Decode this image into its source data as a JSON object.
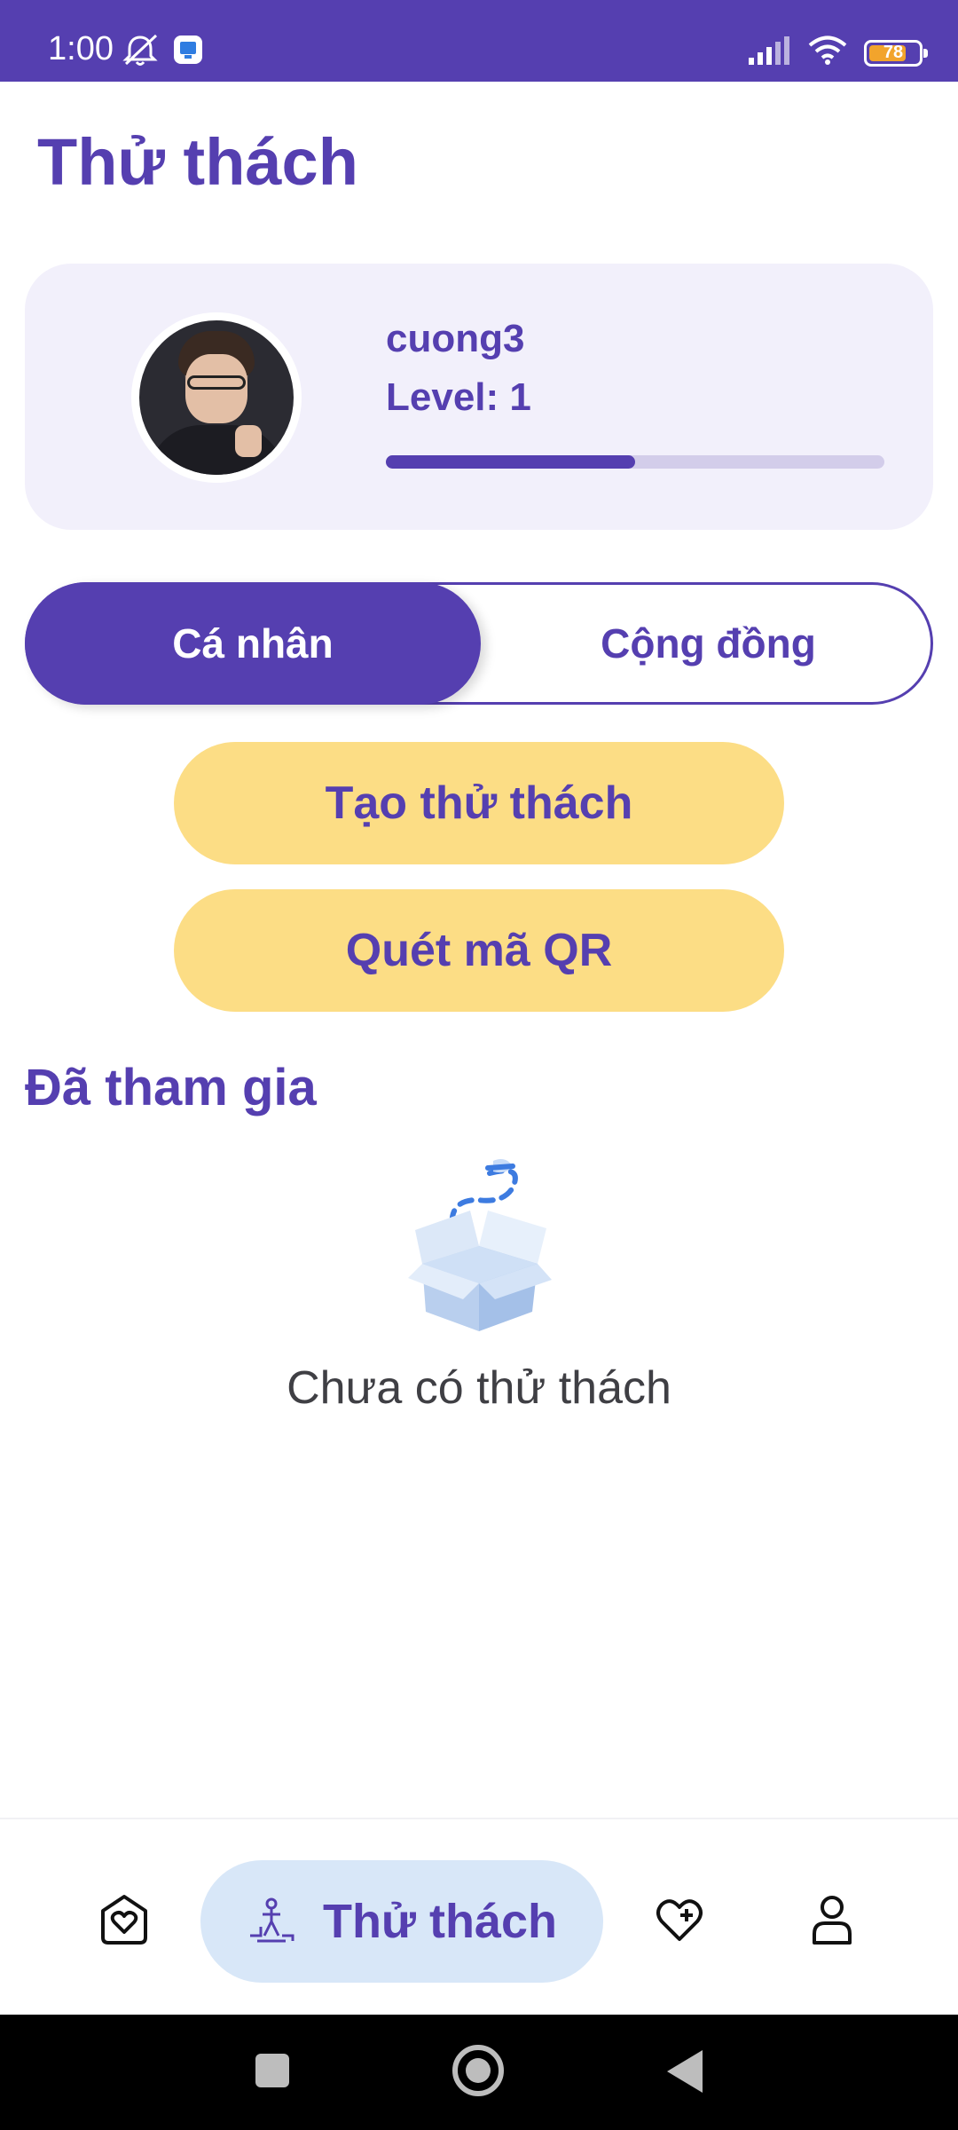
{
  "status_bar": {
    "time": "1:00",
    "battery_level": "78",
    "battery_fraction": 0.78,
    "icons": [
      "alarm-off-icon",
      "app-notification-icon",
      "signal-icon",
      "wifi-icon",
      "battery-icon"
    ]
  },
  "page": {
    "title": "Thử thách"
  },
  "profile": {
    "username": "cuong3",
    "level_label": "Level: 1",
    "progress_fraction": 0.5
  },
  "tabs": {
    "personal_label": "Cá nhân",
    "community_label": "Cộng đồng",
    "selected": "personal"
  },
  "actions": {
    "create_label": "Tạo thử thách",
    "scan_label": "Quét mã QR"
  },
  "joined": {
    "section_title": "Đã tham gia",
    "empty_text": "Chưa có thử thách",
    "empty_icon": "empty-box-icon"
  },
  "bottom_nav": {
    "items": [
      {
        "icon": "home-heart-icon",
        "label": ""
      },
      {
        "icon": "challenge-icon",
        "label": "Thử thách",
        "active": true
      },
      {
        "icon": "heart-plus-icon",
        "label": ""
      },
      {
        "icon": "person-icon",
        "label": ""
      }
    ]
  },
  "colors": {
    "primary": "#553fb0",
    "card_bg": "#f2f0fb",
    "button_yellow": "#fcdd85",
    "nav_active_bg": "#d8e7f8",
    "progress_track": "#d3cdea"
  }
}
